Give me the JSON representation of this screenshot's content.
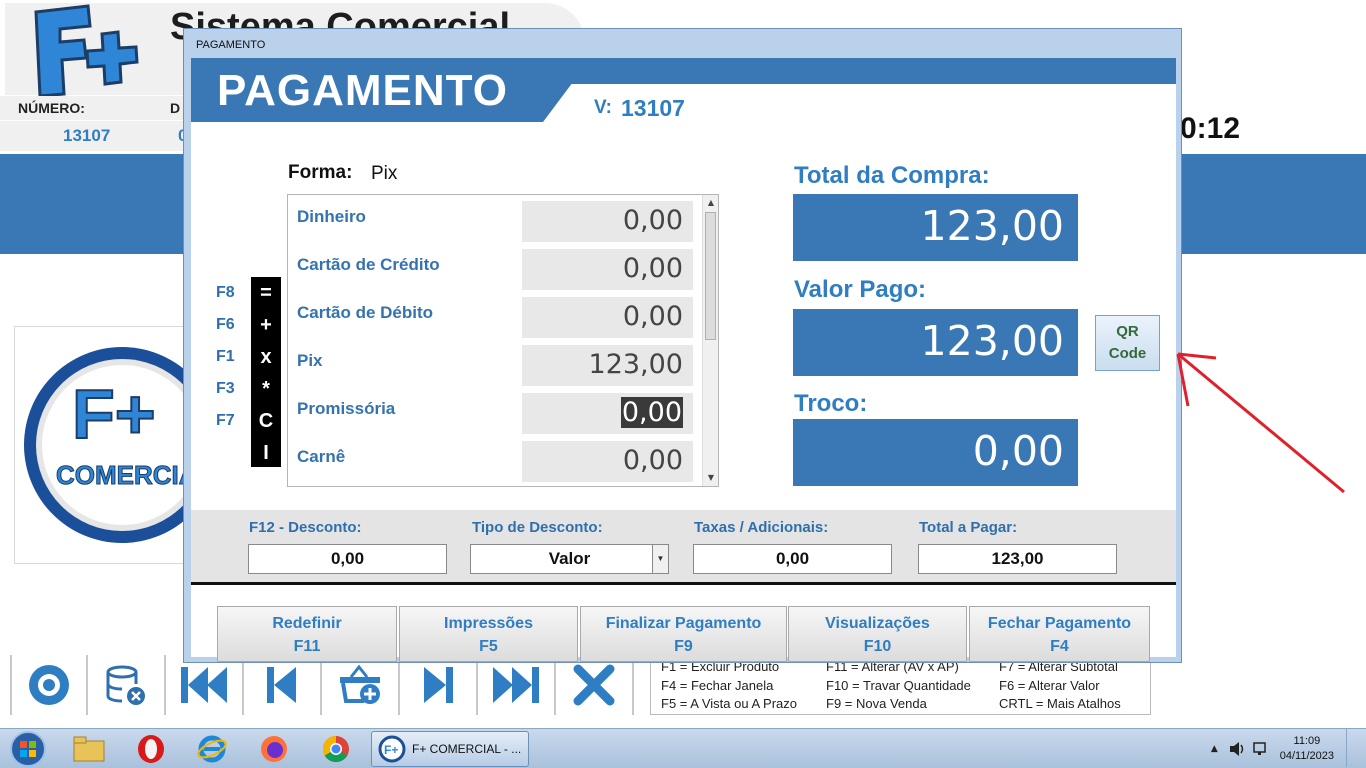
{
  "background_app": {
    "title": "Sistema Comercial",
    "numero_label": "NÚMERO:",
    "d_label": "D",
    "numero_value": "13107",
    "d_value": "0",
    "time_partial": "0:12",
    "logo_text": "F+",
    "comercial_text": "COMERCIAL"
  },
  "shortcuts": {
    "col1": [
      "F1 = Excluir Produto",
      "F4 = Fechar Janela",
      "F5 = A Vista ou A Prazo"
    ],
    "col2": [
      "F11 = Alterar (AV x AP)",
      "F10 = Travar Quantidade",
      "F9 = Nova Venda"
    ],
    "col3": [
      "F7 = Alterar Subtotal",
      "F6 = Alterar Valor",
      "CRTL = Mais Atalhos"
    ]
  },
  "dialog": {
    "window_title": "PAGAMENTO",
    "header_title": "PAGAMENTO",
    "v_label": "V:",
    "v_value": "13107",
    "forma_label": "Forma:",
    "forma_value": "Pix",
    "key_labels": [
      "F8",
      "F6",
      "F1",
      "F3",
      "F7"
    ],
    "operators": [
      "=",
      "+",
      "x",
      "*",
      "C",
      "I"
    ],
    "payments": [
      {
        "name": "Dinheiro",
        "value": "0,00"
      },
      {
        "name": "Cartão de Crédito",
        "value": "0,00"
      },
      {
        "name": "Cartão de Débito",
        "value": "0,00"
      },
      {
        "name": "Pix",
        "value": "123,00"
      },
      {
        "name": "Promissória",
        "value": "0,00"
      },
      {
        "name": "Carnê",
        "value": "0,00"
      }
    ],
    "selected_payment": "Promissória",
    "total_compra_label": "Total da Compra:",
    "total_compra_value": "123,00",
    "valor_pago_label": "Valor Pago:",
    "valor_pago_value": "123,00",
    "troco_label": "Troco:",
    "troco_value": "0,00",
    "qr_line1": "QR",
    "qr_line2": "Code",
    "summary": {
      "desconto_label": "F12 - Desconto:",
      "desconto_value": "0,00",
      "tipo_label": "Tipo de Desconto:",
      "tipo_value": "Valor",
      "taxas_label": "Taxas / Adicionais:",
      "taxas_value": "0,00",
      "total_pagar_label": "Total a Pagar:",
      "total_pagar_value": "123,00"
    },
    "actions": [
      {
        "label": "Redefinir",
        "key": "F11"
      },
      {
        "label": "Impressões",
        "key": "F5"
      },
      {
        "label": "Finalizar Pagamento",
        "key": "F9"
      },
      {
        "label": "Visualizações",
        "key": "F10"
      },
      {
        "label": "Fechar Pagamento",
        "key": "F4"
      }
    ]
  },
  "taskbar": {
    "task_label": "F+ COMERCIAL - ...",
    "clock_time": "11:09",
    "clock_date": "04/11/2023"
  },
  "colors": {
    "brand_blue": "#3a78b5",
    "label_blue": "#2f7dc2",
    "annotation_red": "#e0202a"
  },
  "icons": [
    "disc-icon",
    "database-remove-icon",
    "skip-first-icon",
    "previous-icon",
    "basket-add-icon",
    "next-icon",
    "skip-last-icon",
    "close-x-icon"
  ]
}
